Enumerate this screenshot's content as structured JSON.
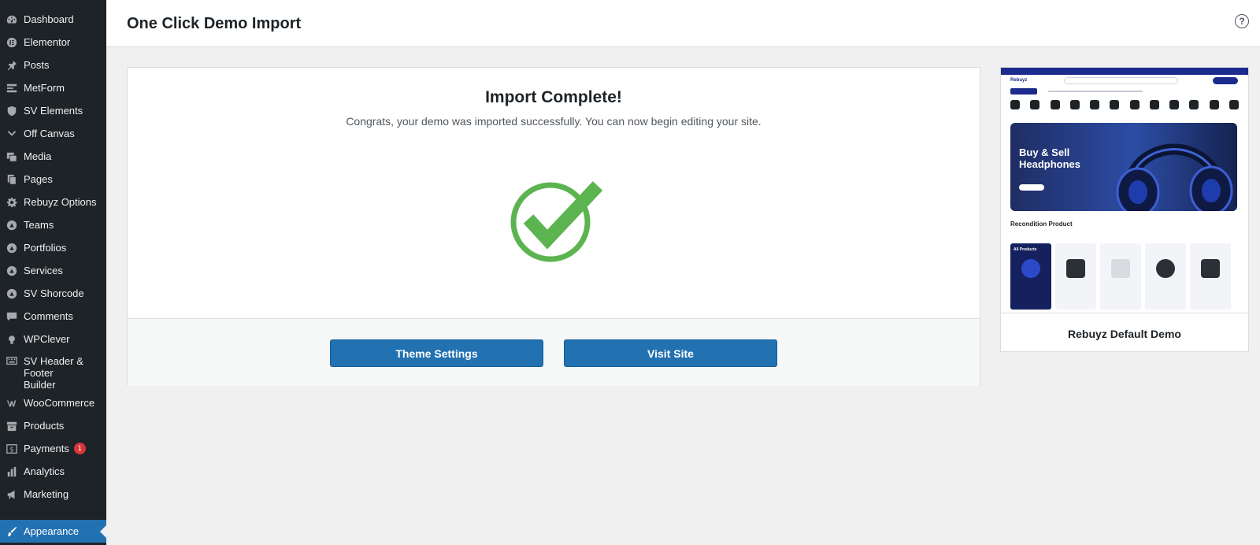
{
  "sidebar": {
    "items": [
      {
        "label": "Dashboard",
        "icon": "dashboard-icon"
      },
      {
        "label": "Elementor",
        "icon": "elementor-icon"
      },
      {
        "label": "Posts",
        "icon": "pin-icon"
      },
      {
        "label": "MetForm",
        "icon": "form-icon"
      },
      {
        "label": "SV Elements",
        "icon": "shield-icon"
      },
      {
        "label": "Off Canvas",
        "icon": "chevron-down-icon"
      },
      {
        "label": "Media",
        "icon": "media-icon"
      },
      {
        "label": "Pages",
        "icon": "pages-icon"
      },
      {
        "label": "Rebuyz Options",
        "icon": "gear-icon"
      },
      {
        "label": "Teams",
        "icon": "circle-icon"
      },
      {
        "label": "Portfolios",
        "icon": "circle-icon"
      },
      {
        "label": "Services",
        "icon": "circle-icon"
      },
      {
        "label": "SV Shorcode",
        "icon": "circle-icon"
      },
      {
        "label": "Comments",
        "icon": "comment-icon"
      },
      {
        "label": "WPClever",
        "icon": "bulb-icon"
      },
      {
        "label": "SV Header & Footer Builder",
        "icon": "keyboard-icon"
      },
      {
        "label": "WooCommerce",
        "icon": "woo-icon"
      },
      {
        "label": "Products",
        "icon": "archive-icon"
      },
      {
        "label": "Payments",
        "icon": "dollar-icon",
        "badge": "1"
      },
      {
        "label": "Analytics",
        "icon": "bar-chart-icon"
      },
      {
        "label": "Marketing",
        "icon": "megaphone-icon"
      },
      {
        "label": "Appearance",
        "icon": "brush-icon"
      }
    ]
  },
  "header": {
    "title": "One Click Demo Import",
    "help_icon": "?"
  },
  "import": {
    "title": "Import Complete!",
    "subtitle": "Congrats, your demo was imported successfully. You can now begin editing your site.",
    "success_color": "#5cb450",
    "buttons": {
      "theme_settings": "Theme Settings",
      "visit_site": "Visit Site"
    }
  },
  "preview": {
    "name": "Rebuyz Default Demo",
    "site": {
      "logo": "Rebuyz",
      "hero_line1": "Buy & Sell",
      "hero_line2": "Headphones",
      "section": "Recondition Product",
      "all_products": "All Products"
    }
  },
  "colors": {
    "sidebar_bg": "#1d2327",
    "accent": "#2271b1",
    "badge": "#d63638"
  }
}
